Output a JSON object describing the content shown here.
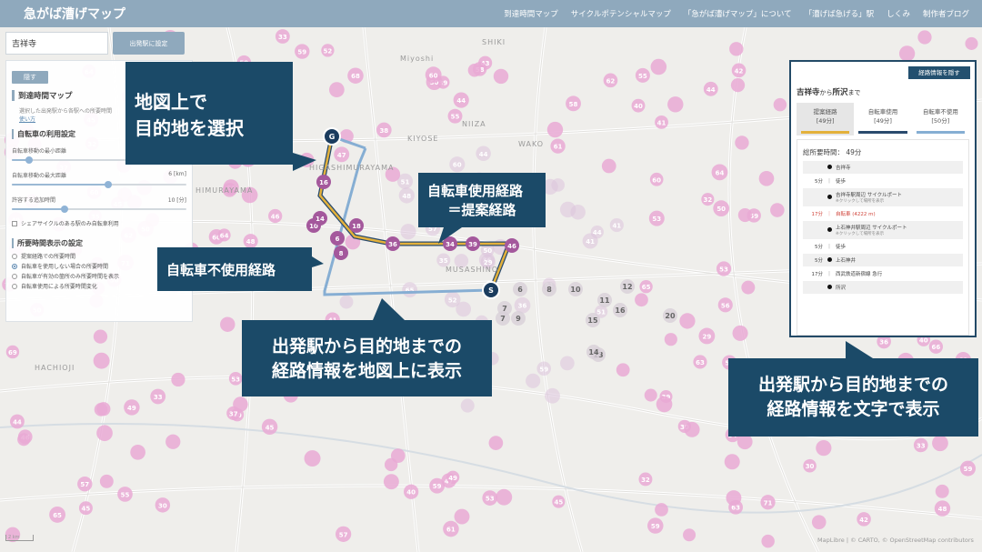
{
  "header": {
    "brand": "急がば漕げマップ",
    "nav": [
      "到達時間マップ",
      "サイクルポテンシャルマップ",
      "「急がば漕げマップ」について",
      "「漕げば急げる」駅",
      "しくみ",
      "制作者ブログ"
    ]
  },
  "search": {
    "value": "吉祥寺",
    "button": "出発駅に設定"
  },
  "left_panel": {
    "hide_label": "隠す",
    "section_title": "到達時間マップ",
    "description": "選択した出発駅から各駅への所要時間",
    "howto": "使い方",
    "bike_settings_title": "自転車の利用設定",
    "min_distance_label": "自転車移動の最小距離",
    "min_distance_value": 0.1,
    "max_distance_label": "自転車移動の最大距離",
    "max_distance_unit": "6 [km]",
    "max_distance_value": 0.55,
    "extra_time_label": "許容する追加時間",
    "extra_time_unit": "10 [分]",
    "extra_time_value": 0.3,
    "share_cycle_only": "シェアサイクルのある駅のみ自転車利用",
    "time_display_title": "所要時間表示の設定",
    "radio_options": [
      "提案経路での所要時間",
      "自転車を使用しない場合の所要時間",
      "自転車が有効の箇所のみ所要時間を表示",
      "自転車使用による所要時間変化"
    ],
    "radio_selected": 1
  },
  "right_panel": {
    "hide_label": "経路情報を隠す",
    "from": "吉祥寺",
    "to_connector": "から",
    "to": "所沢",
    "suffix": "まで",
    "tabs": [
      {
        "label": "提案経路",
        "time": "[49分]",
        "color": "#e3b13b"
      },
      {
        "label": "自転車使用",
        "time": "[49分]",
        "color": "#2a4b6e"
      },
      {
        "label": "自転車不使用",
        "time": "[50分]",
        "color": "#86aed3"
      }
    ],
    "total_label": "総所要時間：",
    "total_value": "49分",
    "steps": [
      {
        "time": "",
        "mark": "dot",
        "name": "吉祥寺",
        "sub": "",
        "stop": true
      },
      {
        "time": "5分",
        "mark": "｜",
        "name": "徒歩",
        "sub": "",
        "stop": false
      },
      {
        "time": "",
        "mark": "dot",
        "name": "吉祥寺駅周辺 サイクルポート",
        "sub": "※クリックして場所を表示",
        "stop": true
      },
      {
        "time": "17分",
        "mark": "｜",
        "name": "自転車 (4222 m)",
        "sub": "",
        "stop": false,
        "red": true
      },
      {
        "time": "",
        "mark": "dot",
        "name": "上石神井駅周辺 サイクルポート",
        "sub": "※クリックして場所を表示",
        "stop": true
      },
      {
        "time": "5分",
        "mark": "｜",
        "name": "徒歩",
        "sub": "",
        "stop": false
      },
      {
        "time": "5分",
        "mark": "dot",
        "name": "上石神井",
        "sub": "",
        "stop": true
      },
      {
        "time": "17分",
        "mark": "｜",
        "name": "西武鉄道新宿線 急行",
        "sub": "",
        "stop": false
      },
      {
        "time": "",
        "mark": "dot",
        "name": "所沢",
        "sub": "",
        "stop": true
      }
    ]
  },
  "map": {
    "places": [
      "Miyoshi",
      "SHIKI",
      "NIIZA",
      "KIYOSE",
      "WAKO",
      "HIGASHIMURAYAMA",
      "HIMURAYAMA",
      "MUSASHINO",
      "HACHIOJI"
    ],
    "origin_marker": "S",
    "goal_marker": "G",
    "route_numbers": [
      "6",
      "8",
      "10",
      "14",
      "16",
      "18",
      "36",
      "34",
      "39",
      "46"
    ],
    "grey_numbers": [
      "6",
      "7",
      "8",
      "10",
      "11",
      "12",
      "13",
      "14",
      "15",
      "16",
      "20",
      "7",
      "9"
    ],
    "pink_numbers": [
      "64",
      "59",
      "57",
      "51",
      "55",
      "53",
      "61",
      "65",
      "71",
      "69",
      "60",
      "59",
      "54",
      "59",
      "45",
      "43",
      "41",
      "40",
      "39",
      "38",
      "37",
      "36",
      "35",
      "40",
      "45",
      "48",
      "52",
      "53",
      "60",
      "64",
      "49",
      "50",
      "47",
      "44",
      "42",
      "33",
      "32",
      "29",
      "46",
      "30",
      "43",
      "58",
      "66",
      "41",
      "62",
      "56",
      "44",
      "50",
      "63",
      "68"
    ],
    "attribution": "MapLibre | © CARTO, © OpenStreetMap contributors",
    "scale": "2 km"
  },
  "callouts": {
    "select_goal": [
      "地図上で",
      "目的地を選択"
    ],
    "bike_route": [
      "自転車使用経路",
      "＝提案経路"
    ],
    "no_bike_route": "自転車不使用経路",
    "map_route_info": [
      "出発駅から目的地までの",
      "経路情報を地図上に表示"
    ],
    "text_route_info": [
      "出発駅から目的地までの",
      "経路情報を文字で表示"
    ]
  },
  "colors": {
    "header": "#8fa9bd",
    "callout": "#1b4a68",
    "proposed": "#e3b13b",
    "with_bike": "#2a4b6e",
    "without_bike": "#86aed3",
    "station_pink": "#e9a9d5",
    "station_purple": "#a4589c"
  }
}
